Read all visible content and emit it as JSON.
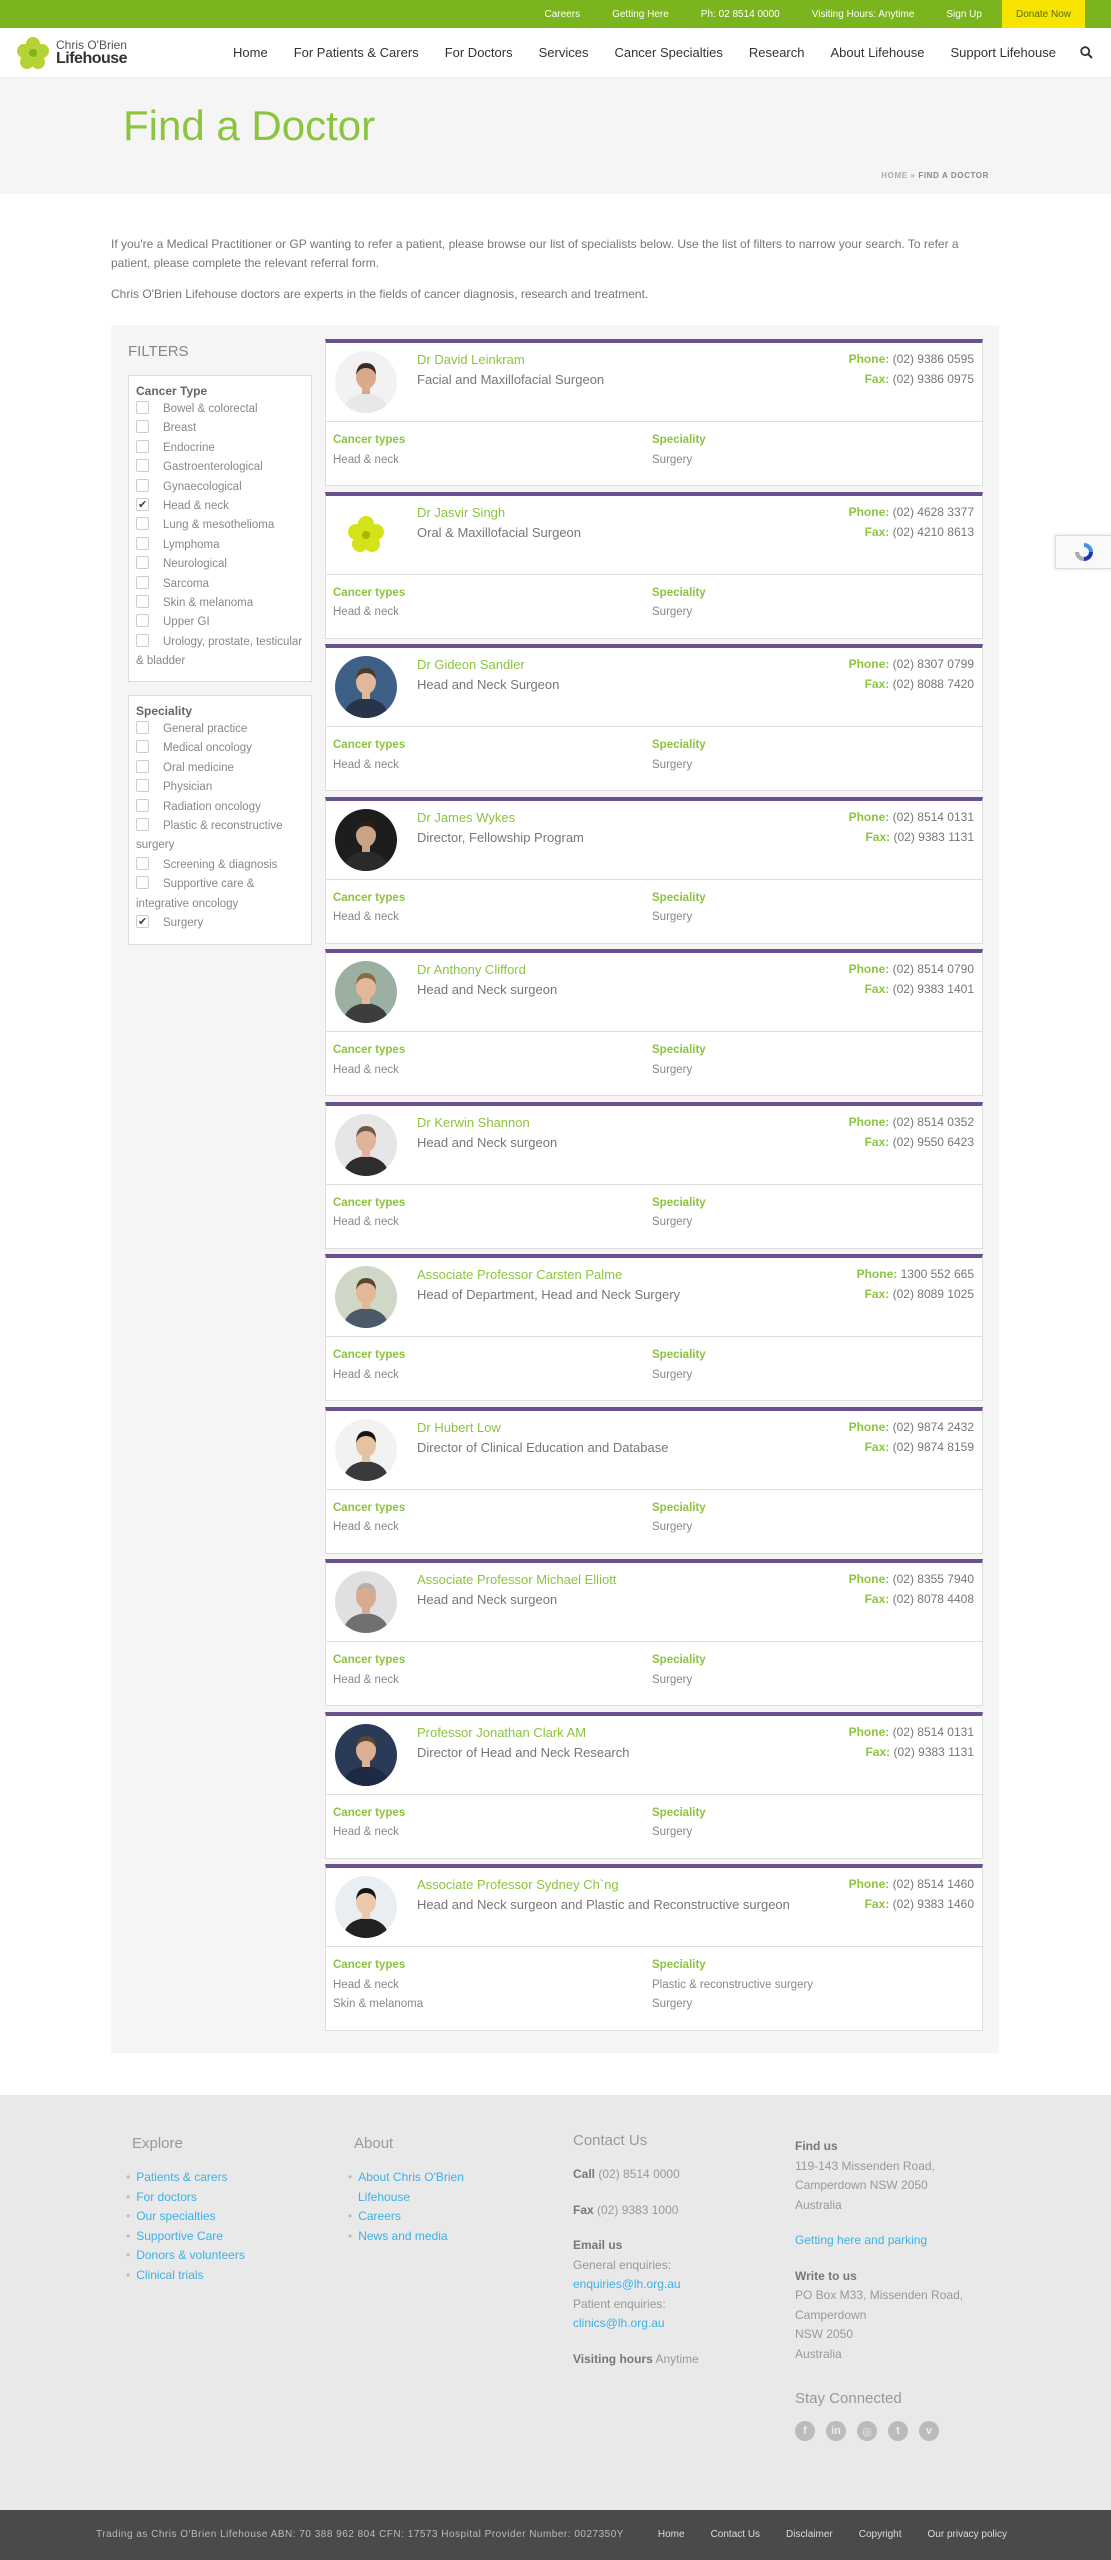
{
  "topbar": {
    "links": [
      "Careers",
      "Getting Here",
      "Ph: 02 8514 0000",
      "Visiting Hours: Anytime",
      "Sign Up"
    ],
    "donate": "Donate Now"
  },
  "logo": {
    "line1": "Chris O'Brien",
    "line2": "Lifehouse"
  },
  "nav": [
    "Home",
    "For Patients & Carers",
    "For Doctors",
    "Services",
    "Cancer Specialties",
    "Research",
    "About Lifehouse",
    "Support Lifehouse"
  ],
  "page": {
    "title": "Find a Doctor",
    "breadcrumb_home": "HOME",
    "breadcrumb_sep": "»",
    "breadcrumb_current": "FIND A DOCTOR"
  },
  "intro": {
    "p1": "If you're a Medical Practitioner or GP wanting to refer a patient, please browse our list of specialists below. Use the list of filters to narrow your search. To refer a patient, please complete the relevant referral form.",
    "p2": "Chris O'Brien Lifehouse doctors are experts in the fields of cancer diagnosis, research and treatment."
  },
  "filters": {
    "heading": "FILTERS",
    "cancer_type": {
      "label": "Cancer Type",
      "options": [
        {
          "label": "Bowel & colorectal",
          "checked": false
        },
        {
          "label": "Breast",
          "checked": false
        },
        {
          "label": "Endocrine",
          "checked": false
        },
        {
          "label": "Gastroenterological",
          "checked": false
        },
        {
          "label": "Gynaecological",
          "checked": false
        },
        {
          "label": "Head & neck",
          "checked": true
        },
        {
          "label": "Lung & mesothelioma",
          "checked": false
        },
        {
          "label": "Lymphoma",
          "checked": false
        },
        {
          "label": "Neurological",
          "checked": false
        },
        {
          "label": "Sarcoma",
          "checked": false
        },
        {
          "label": "Skin & melanoma",
          "checked": false
        },
        {
          "label": "Upper GI",
          "checked": false
        },
        {
          "label": "Urology, prostate, testicular & bladder",
          "checked": false
        }
      ]
    },
    "speciality": {
      "label": "Speciality",
      "options": [
        {
          "label": "General practice",
          "checked": false
        },
        {
          "label": "Medical oncology",
          "checked": false
        },
        {
          "label": "Oral medicine",
          "checked": false
        },
        {
          "label": "Physician",
          "checked": false
        },
        {
          "label": "Radiation oncology",
          "checked": false
        },
        {
          "label": "Plastic & reconstructive surgery",
          "checked": false
        },
        {
          "label": "Screening & diagnosis",
          "checked": false
        },
        {
          "label": "Supportive care & integrative oncology",
          "checked": false
        },
        {
          "label": "Surgery",
          "checked": true
        }
      ]
    }
  },
  "labels": {
    "phone": "Phone:",
    "fax": "Fax:",
    "cancer_types": "Cancer types",
    "speciality": "Speciality"
  },
  "doctors": [
    {
      "name": "Dr David Leinkram",
      "title": "Facial and Maxillofacial Surgeon",
      "phone": "(02) 9386 0595",
      "fax": "(02) 9386 0975",
      "cancer_types": [
        "Head & neck"
      ],
      "speciality": [
        "Surgery"
      ],
      "avatar": "portrait-bearded"
    },
    {
      "name": "Dr Jasvir Singh",
      "title": "Oral & Maxillofacial Surgeon",
      "phone": "(02) 4628 3377",
      "fax": "(02) 4210 8613",
      "cancer_types": [
        "Head & neck"
      ],
      "speciality": [
        "Surgery"
      ],
      "avatar": "lifehouse-flower"
    },
    {
      "name": "Dr Gideon Sandler",
      "title": "Head and Neck Surgeon",
      "phone": "(02) 8307 0799",
      "fax": "(02) 8088 7420",
      "cancer_types": [
        "Head & neck"
      ],
      "speciality": [
        "Surgery"
      ],
      "avatar": "portrait-suit-blue"
    },
    {
      "name": "Dr James Wykes",
      "title": "Director, Fellowship Program",
      "phone": "(02) 8514 0131",
      "fax": "(02) 9383 1131",
      "cancer_types": [
        "Head & neck"
      ],
      "speciality": [
        "Surgery"
      ],
      "avatar": "portrait-dark"
    },
    {
      "name": "Dr Anthony Clifford",
      "title": "Head and Neck surgeon",
      "phone": "(02) 8514 0790",
      "fax": "(02) 9383 1401",
      "cancer_types": [
        "Head & neck"
      ],
      "speciality": [
        "Surgery"
      ],
      "avatar": "portrait-outdoor"
    },
    {
      "name": "Dr Kerwin Shannon",
      "title": "Head and Neck surgeon",
      "phone": "(02) 8514 0352",
      "fax": "(02) 9550 6423",
      "cancer_types": [
        "Head & neck"
      ],
      "speciality": [
        "Surgery"
      ],
      "avatar": "portrait-grey"
    },
    {
      "name": "Associate Professor Carsten Palme",
      "title": "Head of Department, Head and Neck Surgery",
      "phone": "1300 552 665",
      "fax": "(02) 8089 1025",
      "cancer_types": [
        "Head & neck"
      ],
      "speciality": [
        "Surgery"
      ],
      "avatar": "portrait-smile"
    },
    {
      "name": "Dr Hubert Low",
      "title": "Director of Clinical Education and Database",
      "phone": "(02) 9874 2432",
      "fax": "(02) 9874 8159",
      "cancer_types": [
        "Head & neck"
      ],
      "speciality": [
        "Surgery"
      ],
      "avatar": "portrait-glasses"
    },
    {
      "name": "Associate Professor Michael Elliott",
      "title": "Head and Neck surgeon",
      "phone": "(02) 8355 7940",
      "fax": "(02) 8078 4408",
      "cancer_types": [
        "Head & neck"
      ],
      "speciality": [
        "Surgery"
      ],
      "avatar": "portrait-bald"
    },
    {
      "name": "Professor Jonathan Clark AM",
      "title": "Director of Head and Neck Research",
      "phone": "(02) 8514 0131",
      "fax": "(02) 9383 1131",
      "cancer_types": [
        "Head & neck"
      ],
      "speciality": [
        "Surgery"
      ],
      "avatar": "portrait-navy"
    },
    {
      "name": "Associate Professor Sydney Ch`ng",
      "title": "Head and Neck surgeon and Plastic and Reconstructive surgeon",
      "phone": "(02) 8514 1460",
      "fax": "(02) 9383 1460",
      "cancer_types": [
        "Head & neck",
        "Skin & melanoma"
      ],
      "speciality": [
        "Plastic & reconstructive surgery",
        "Surgery"
      ],
      "avatar": "portrait-woman"
    }
  ],
  "footer": {
    "explore": {
      "heading": "Explore",
      "links": [
        "Patients & carers",
        "For doctors",
        "Our specialties",
        "Supportive Care",
        "Donors & volunteers",
        "Clinical trials"
      ]
    },
    "about": {
      "heading": "About",
      "links": [
        "About Chris O'Brien Lifehouse",
        "Careers",
        "News and media"
      ]
    },
    "contact": {
      "heading": "Contact Us",
      "call_label": "Call",
      "call": "(02) 8514 0000",
      "fax_label": "Fax",
      "fax": "(02) 9383 1000",
      "email_label": "Email us",
      "general_label": "General enquiries:",
      "general_email": "enquiries@lh.org.au",
      "patient_label": "Patient enquiries:",
      "patient_email": "clinics@lh.org.au",
      "visiting_label": "Visiting hours",
      "visiting": "Anytime"
    },
    "find": {
      "heading": "Find us",
      "address": [
        "119-143 Missenden Road,",
        "Camperdown NSW 2050",
        "Australia"
      ],
      "parking": "Getting here and parking",
      "write_heading": "Write to us",
      "postal": [
        "PO Box M33, Missenden Road,",
        "Camperdown",
        "NSW 2050",
        "Australia"
      ],
      "stay": "Stay Connected",
      "social": [
        "facebook-icon",
        "linkedin-icon",
        "instagram-icon",
        "twitter-icon",
        "vimeo-icon"
      ]
    }
  },
  "bottom": {
    "legal": "Trading as Chris O'Brien Lifehouse ABN: 70 388 962 804 CFN: 17573 Hospital Provider Number: 0027350Y",
    "links": [
      "Home",
      "Contact Us",
      "Disclaimer",
      "Copyright",
      "Our privacy policy"
    ]
  }
}
